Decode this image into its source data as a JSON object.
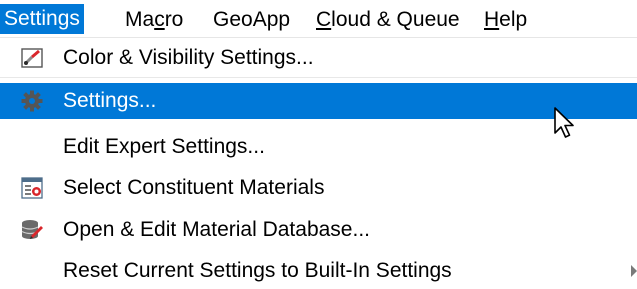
{
  "menubar": {
    "items": [
      {
        "label": "Settings"
      },
      {
        "pre": "Ma",
        "accel": "c",
        "post": "ro"
      },
      {
        "label": "GeoApp"
      },
      {
        "accel": "C",
        "post": "loud & Queue"
      },
      {
        "accel": "H",
        "post": "elp"
      }
    ]
  },
  "menu": {
    "items": [
      {
        "label": "Color & Visibility Settings...",
        "icon": "color-visibility-icon"
      },
      {
        "label": "Settings...",
        "icon": "gear-icon"
      },
      {
        "label": "Edit Expert Settings..."
      },
      {
        "label": "Select Constituent Materials",
        "icon": "constituent-materials-icon"
      },
      {
        "label": "Open & Edit Material Database...",
        "icon": "material-database-icon"
      },
      {
        "label": "Reset Current Settings to Built-In Settings"
      }
    ]
  },
  "colors": {
    "highlight": "#0078d7",
    "menubar_active": "#0078d7"
  }
}
